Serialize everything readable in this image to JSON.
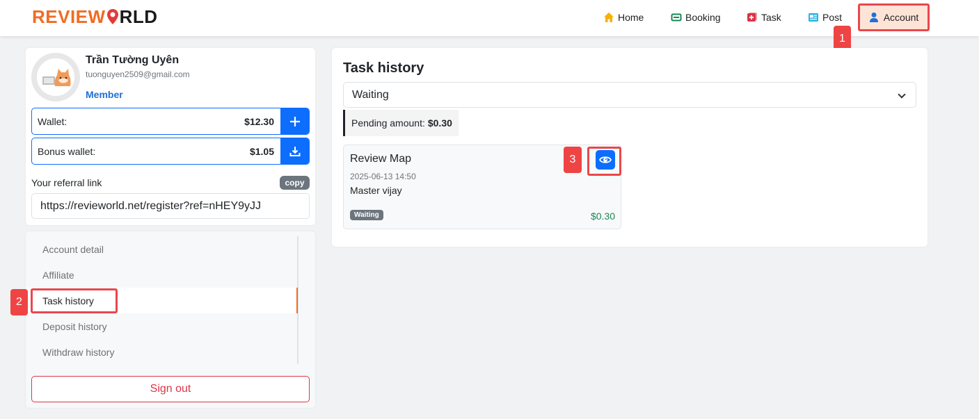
{
  "brand": {
    "logo_left": "REVIEW",
    "logo_right": "RLD",
    "colors": {
      "orange": "#f26b22",
      "primary": "#0d6efd",
      "danger": "#dc3545",
      "success": "#198754"
    }
  },
  "nav": {
    "items": [
      {
        "label": "Home",
        "icon": "house-icon"
      },
      {
        "label": "Booking",
        "icon": "ticket-icon"
      },
      {
        "label": "Task",
        "icon": "plus-square-icon"
      },
      {
        "label": "Post",
        "icon": "newspaper-icon"
      },
      {
        "label": "Account",
        "icon": "person-icon",
        "active": true
      }
    ]
  },
  "callouts": {
    "one": "1",
    "two": "2",
    "three": "3"
  },
  "profile": {
    "name": "Trần Tường Uyên",
    "email": "tuonguyen2509@gmail.com",
    "role": "Member",
    "wallet_label": "Wallet:",
    "wallet_value": "$12.30",
    "bonus_label": "Bonus wallet:",
    "bonus_value": "$1.05",
    "referral_label": "Your referral link",
    "copy_label": "copy",
    "referral_link": "https://revieworld.net/register?ref=nHEY9yJJ"
  },
  "menu": {
    "items": [
      {
        "label": "Account detail"
      },
      {
        "label": "Affiliate"
      },
      {
        "label": "Task history",
        "active": true
      },
      {
        "label": "Deposit history"
      },
      {
        "label": "Withdraw history"
      }
    ],
    "signout": "Sign out"
  },
  "main": {
    "title": "Task history",
    "filter_value": "Waiting",
    "pending_label": "Pending amount:",
    "pending_value": "$0.30",
    "tasks": [
      {
        "title": "Review Map",
        "date": "2025-06-13 14:50",
        "description": "Master vijay",
        "status": "Waiting",
        "amount": "$0.30"
      }
    ]
  }
}
